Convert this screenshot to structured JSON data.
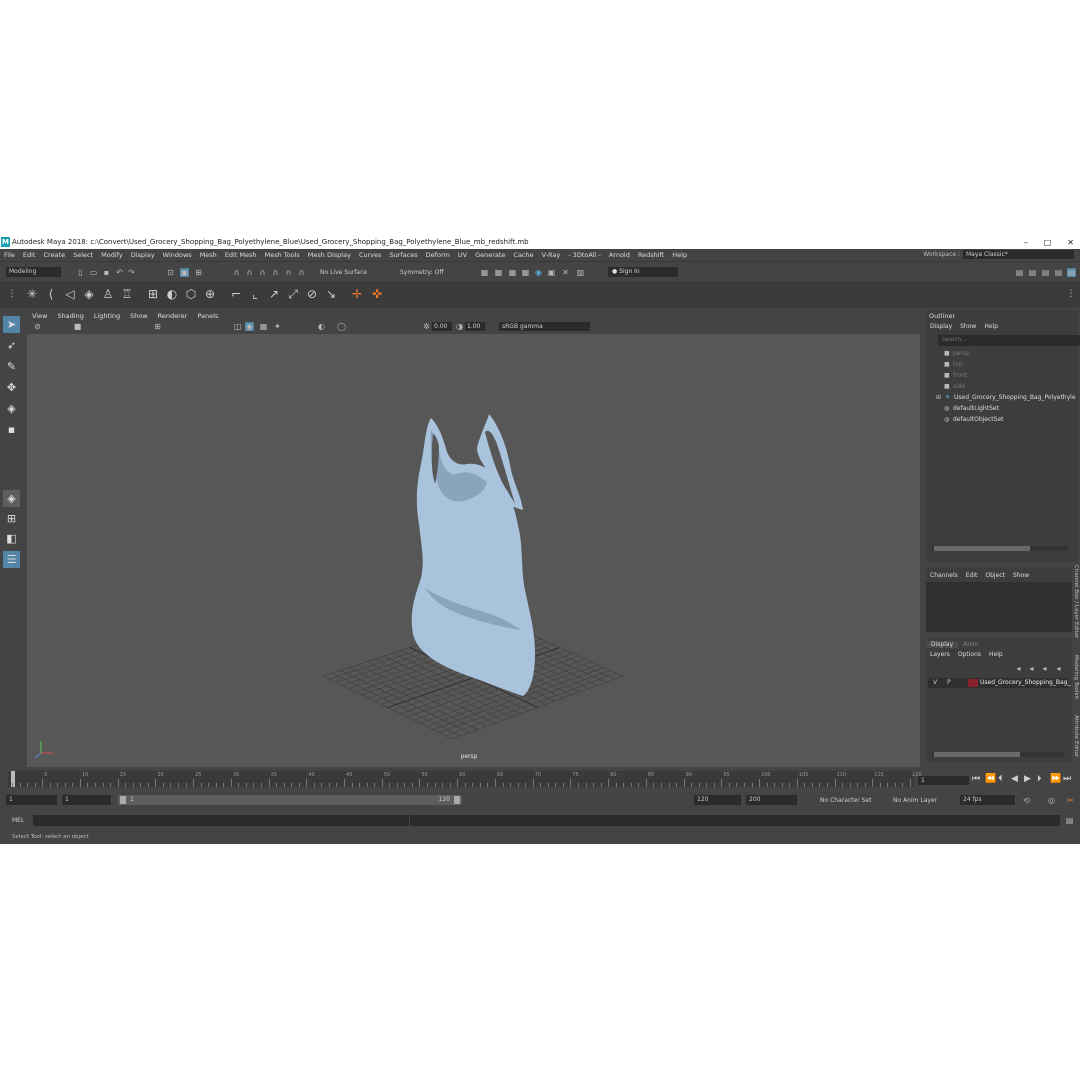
{
  "window": {
    "title": "Autodesk Maya 2018: c:\\Convert\\Used_Grocery_Shopping_Bag_Polyethylene_Blue\\Used_Grocery_Shopping_Bag_Polyethylene_Blue_mb_redshift.mb",
    "logo": "M",
    "minimize": "–",
    "maximize": "□",
    "close": "✕"
  },
  "menubar": [
    "File",
    "Edit",
    "Create",
    "Select",
    "Modify",
    "Display",
    "Windows",
    "Mesh",
    "Edit Mesh",
    "Mesh Tools",
    "Mesh Display",
    "Curves",
    "Surfaces",
    "Deform",
    "UV",
    "Generate",
    "Cache",
    "V-Ray",
    "- 3DtoAll -",
    "Arnold",
    "Redshift",
    "Help"
  ],
  "workspace": {
    "label": "Workspace :",
    "value": "Maya Classic*"
  },
  "status": {
    "mode": "Modeling",
    "live_surface": "No Live Surface",
    "symmetry": "Symmetry: Off",
    "sign_in": "Sign In"
  },
  "viewport": {
    "menu": [
      "View",
      "Shading",
      "Lighting",
      "Show",
      "Renderer",
      "Panels"
    ],
    "exposure": "0.00",
    "gamma": "1.00",
    "color_space": "sRGB gamma",
    "camera_label": "persp",
    "colors": {
      "background": "#575757",
      "bag": "#a9c3dc",
      "grid": "#3f3f3f"
    }
  },
  "outliner": {
    "title": "Outliner",
    "menu": [
      "Display",
      "Show",
      "Help"
    ],
    "search_placeholder": "Search...",
    "items": [
      {
        "label": "persp",
        "icon": "camera-icon",
        "dim": true
      },
      {
        "label": "top",
        "icon": "camera-icon",
        "dim": true
      },
      {
        "label": "front",
        "icon": "camera-icon",
        "dim": true
      },
      {
        "label": "side",
        "icon": "camera-icon",
        "dim": true
      },
      {
        "label": "Used_Grocery_Shopping_Bag_Polyethyle",
        "icon": "transform-icon",
        "dim": false
      },
      {
        "label": "defaultLightSet",
        "icon": "set-icon",
        "dim": false
      },
      {
        "label": "defaultObjectSet",
        "icon": "set-icon",
        "dim": false
      }
    ]
  },
  "channel_box": {
    "menu": [
      "Channels",
      "Edit",
      "Object",
      "Show"
    ]
  },
  "layer_editor": {
    "tabs": [
      "Display",
      "Anim"
    ],
    "menu": [
      "Layers",
      "Options",
      "Help"
    ],
    "layer": {
      "v": "V",
      "p": "P",
      "name": "Used_Grocery_Shopping_Bag_",
      "color": "#8a1f2e"
    }
  },
  "side_tabs": [
    "Channel Box / Layer Editor",
    "Modeling Toolkit",
    "Attribute Editor"
  ],
  "timeline": {
    "ticks": [
      "5",
      "10",
      "15",
      "20",
      "25",
      "30",
      "35",
      "40",
      "45",
      "50",
      "55",
      "60",
      "65",
      "70",
      "75",
      "80",
      "85",
      "90",
      "95",
      "100",
      "105",
      "110",
      "115",
      "120"
    ],
    "current_frame": "1"
  },
  "range": {
    "start": "1",
    "playback_start": "1",
    "slider_start": "1",
    "slider_end": "120",
    "playback_end": "120",
    "end": "200",
    "character_set": "No Character Set",
    "anim_layer": "No Anim Layer",
    "fps": "24 fps"
  },
  "command": {
    "lang": "MEL"
  },
  "help_line": "Select Tool: select an object"
}
